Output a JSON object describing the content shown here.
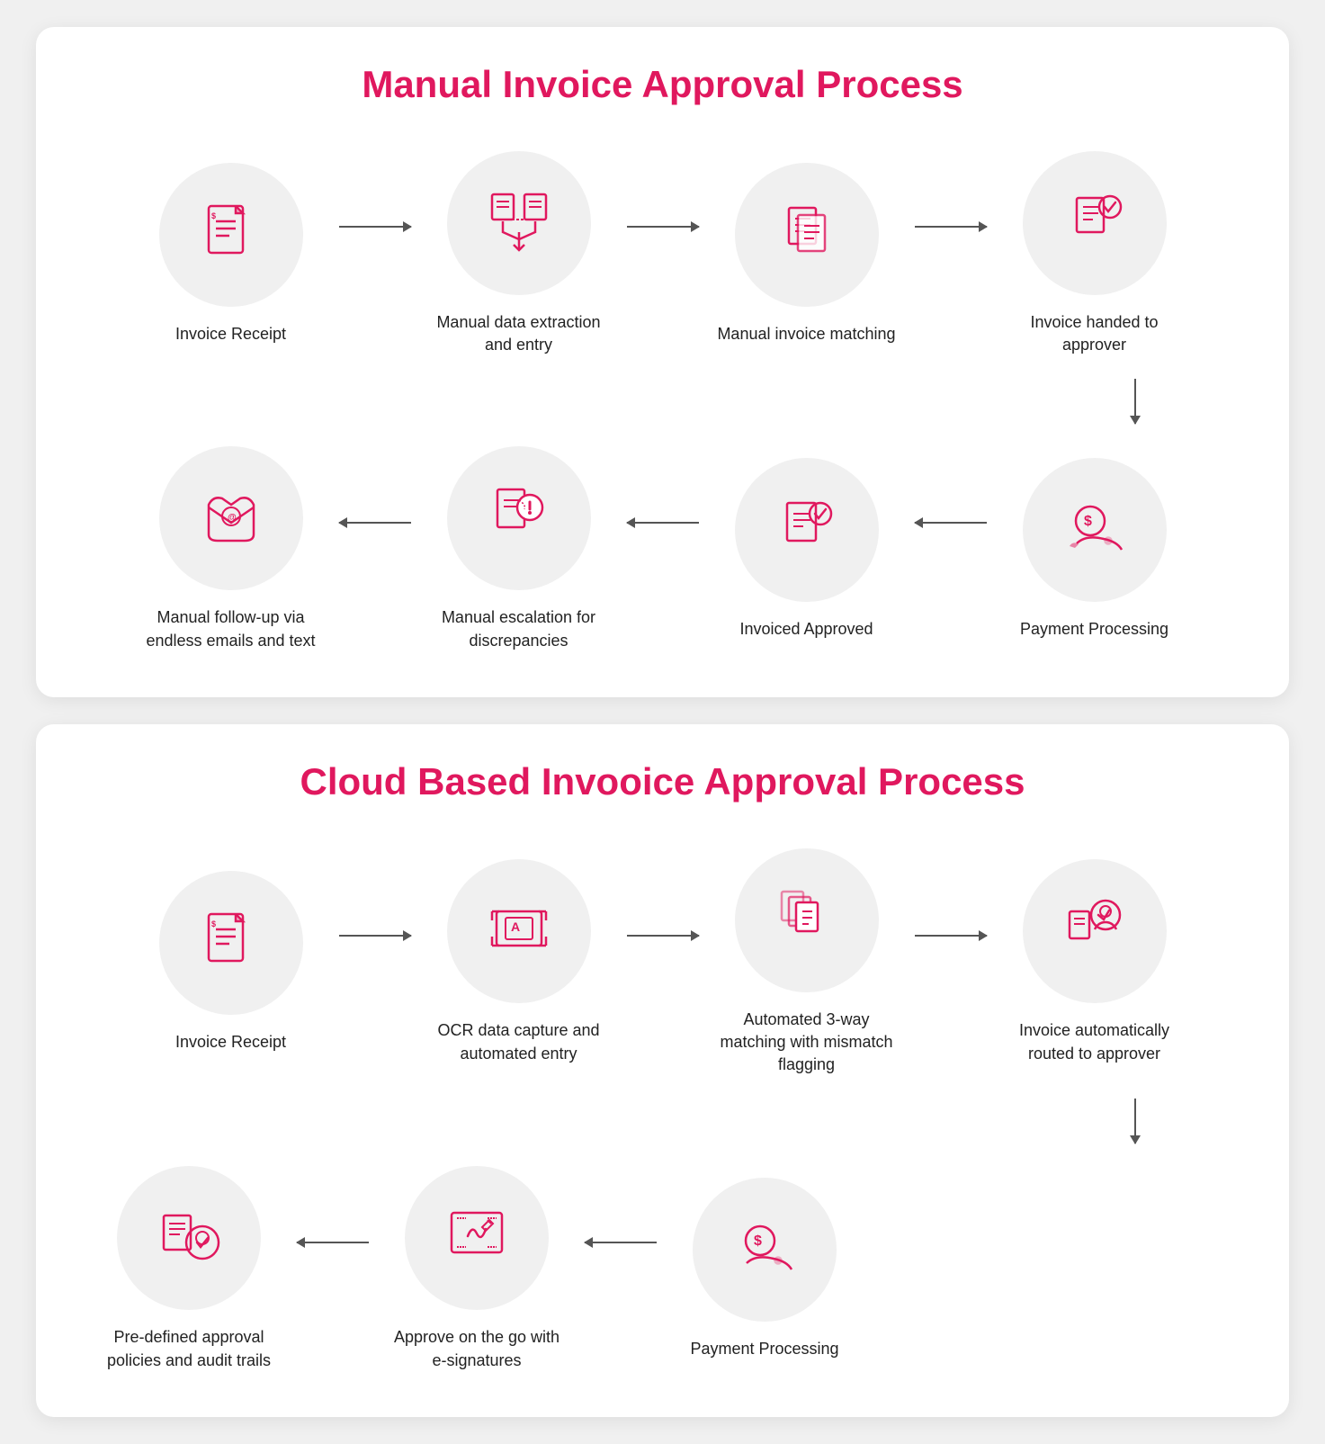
{
  "section1": {
    "title": "Manual Invoice Approval Process",
    "row1": [
      {
        "id": "invoice-receipt-1",
        "label": "Invoice Receipt",
        "icon": "invoice"
      },
      {
        "id": "manual-data-extraction",
        "label": "Manual data extraction and entry",
        "icon": "data-extraction"
      },
      {
        "id": "manual-invoice-matching",
        "label": "Manual invoice matching",
        "icon": "invoice-matching"
      },
      {
        "id": "invoice-handed-approver",
        "label": "Invoice handed to approver",
        "icon": "invoice-approved"
      }
    ],
    "row2": [
      {
        "id": "payment-processing-1",
        "label": "Payment Processing",
        "icon": "payment"
      },
      {
        "id": "invoiced-approved",
        "label": "Invoiced Approved",
        "icon": "approved"
      },
      {
        "id": "manual-escalation",
        "label": "Manual escalation for discrepancies",
        "icon": "escalation"
      },
      {
        "id": "manual-followup",
        "label": "Manual follow-up via endless emails and text",
        "icon": "email"
      }
    ]
  },
  "section2": {
    "title": "Cloud Based Invooice Approval Process",
    "row1": [
      {
        "id": "invoice-receipt-2",
        "label": "Invoice Receipt",
        "icon": "invoice"
      },
      {
        "id": "ocr-data-capture",
        "label": "OCR data capture and automated entry",
        "icon": "ocr"
      },
      {
        "id": "automated-matching",
        "label": "Automated 3-way matching with mismatch flagging",
        "icon": "auto-matching"
      },
      {
        "id": "invoice-auto-routed",
        "label": "Invoice automatically routed to approver",
        "icon": "auto-approver"
      }
    ],
    "row2": [
      {
        "id": "payment-processing-2",
        "label": "Payment Processing",
        "icon": "payment"
      },
      {
        "id": "approve-on-go",
        "label": "Approve on the go with e-signatures",
        "icon": "esignature"
      },
      {
        "id": "predefined-approval",
        "label": "Pre-defined approval policies and audit trails",
        "icon": "audit"
      }
    ]
  }
}
